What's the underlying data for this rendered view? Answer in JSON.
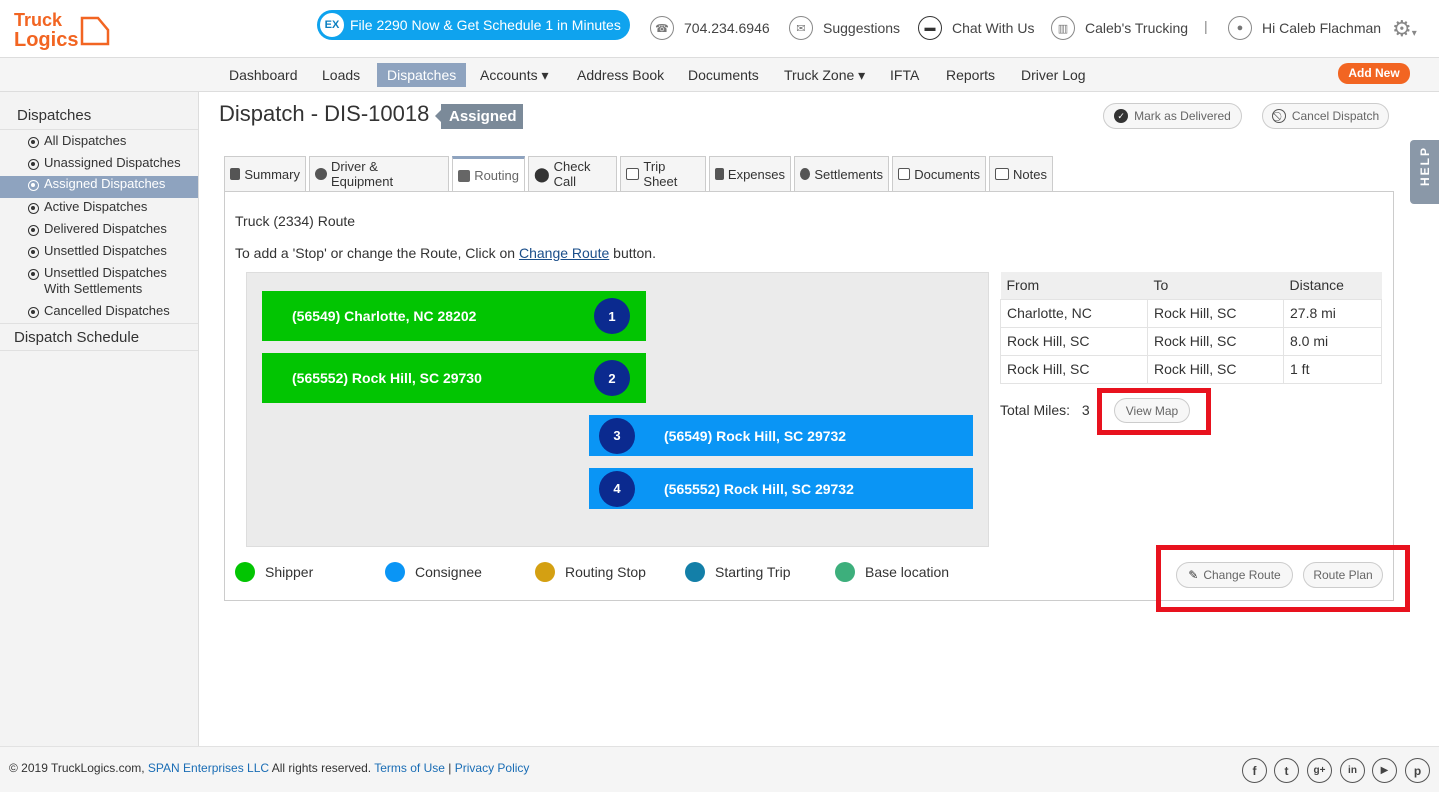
{
  "header": {
    "logo_line1": "Truck",
    "logo_line2": "Logics",
    "promo_badge": "EX",
    "promo_text": "File 2290 Now & Get Schedule 1 in Minutes",
    "phone": "704.234.6946",
    "suggestions": "Suggestions",
    "chat": "Chat With Us",
    "company": "Caleb's Trucking",
    "separator": "|",
    "greeting": "Hi Caleb Flachman"
  },
  "nav": {
    "items": [
      "Dashboard",
      "Loads",
      "Dispatches",
      "Accounts ▾",
      "Address Book",
      "Documents",
      "Truck Zone ▾",
      "IFTA",
      "Reports",
      "Driver Log"
    ],
    "active": "Dispatches",
    "add_new": "Add New"
  },
  "sidebar": {
    "heading": "Dispatches",
    "items": [
      "All Dispatches",
      "Unassigned Dispatches",
      "Assigned Dispatches",
      "Active Dispatches",
      "Delivered Dispatches",
      "Unsettled Dispatches",
      "Unsettled Dispatches With Settlements",
      "Cancelled Dispatches"
    ],
    "active": "Assigned Dispatches",
    "schedule": "Dispatch Schedule"
  },
  "page": {
    "title": "Dispatch - DIS-10018",
    "status": "Assigned",
    "mark_delivered": "Mark as Delivered",
    "cancel_dispatch": "Cancel Dispatch",
    "help": "HELP"
  },
  "tabs": [
    "Summary",
    "Driver & Equipment",
    "Routing",
    "Check Call",
    "Trip Sheet",
    "Expenses",
    "Settlements",
    "Documents",
    "Notes"
  ],
  "active_tab": "Routing",
  "routing": {
    "title": "Truck (2334) Route",
    "help_prefix": "To add a 'Stop' or change the Route, Click on ",
    "help_link": "Change Route",
    "help_suffix": " button.",
    "stops": [
      {
        "num": "1",
        "label": "(56549) Charlotte, NC 28202",
        "type": "shipper"
      },
      {
        "num": "2",
        "label": "(565552) Rock Hill, SC 29730",
        "type": "shipper"
      },
      {
        "num": "3",
        "label": "(56549) Rock Hill, SC 29732",
        "type": "consignee"
      },
      {
        "num": "4",
        "label": "(565552) Rock Hill, SC 29732",
        "type": "consignee"
      }
    ],
    "table": {
      "headers": [
        "From",
        "To",
        "Distance"
      ],
      "rows": [
        [
          "Charlotte, NC",
          "Rock Hill, SC",
          "27.8 mi"
        ],
        [
          "Rock Hill, SC",
          "Rock Hill, SC",
          "8.0 mi"
        ],
        [
          "Rock Hill, SC",
          "Rock Hill, SC",
          "1 ft"
        ]
      ]
    },
    "total_label": "Total Miles:",
    "total_value": "3",
    "view_map": "View Map",
    "change_route": "Change Route",
    "route_plan": "Route Plan",
    "legend": [
      {
        "label": "Shipper",
        "color": "#02c502"
      },
      {
        "label": "Consignee",
        "color": "#0a95f5"
      },
      {
        "label": "Routing Stop",
        "color": "#d4a012"
      },
      {
        "label": "Starting Trip",
        "color": "#137fa8"
      },
      {
        "label": "Base location",
        "color": "#3daf7c"
      }
    ]
  },
  "footer": {
    "copyright": "© 2019 TruckLogics.com, ",
    "company_link": "SPAN Enterprises LLC",
    "rights": " All rights reserved. ",
    "terms": "Terms of Use",
    "sep": " | ",
    "privacy": "Privacy Policy",
    "social": [
      "f",
      "t",
      "g+",
      "in",
      "▶",
      "p"
    ]
  },
  "colors": {
    "accent": "#8ea3bf",
    "shipper": "#02c502",
    "consignee": "#0a95f5",
    "stop_badge": "#0b2a8f",
    "highlight": "#e8121e",
    "add_new": "#f26522",
    "promo": "#0fa3ee"
  }
}
